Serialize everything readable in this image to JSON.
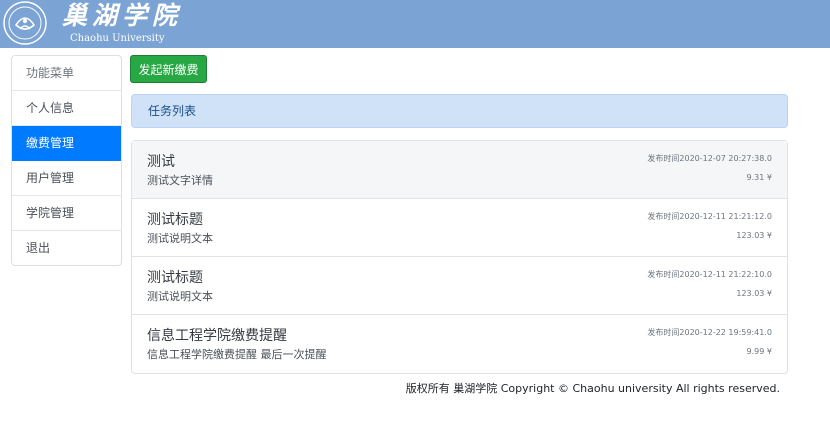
{
  "header": {
    "brand_cn": "巢湖学院",
    "brand_en": "Chaohu University",
    "colors": {
      "bar": "#7ba3d3"
    }
  },
  "sidebar": {
    "items": [
      {
        "label": "功能菜单",
        "type": "header"
      },
      {
        "label": "个人信息"
      },
      {
        "label": "缴费管理",
        "active": true
      },
      {
        "label": "用户管理"
      },
      {
        "label": "学院管理"
      },
      {
        "label": "退出"
      }
    ],
    "active_color": "#007bff"
  },
  "actions": {
    "new_payment_label": "发起新缴费"
  },
  "task_panel": {
    "title": "任务列表"
  },
  "tasks": [
    {
      "title": "测试",
      "desc": "测试文字详情",
      "time": "发布时间2020-12-07 20:27:38.0",
      "amount": "9.31 ¥"
    },
    {
      "title": "测试标题",
      "desc": "测试说明文本",
      "time": "发布时间2020-12-11 21:21:12.0",
      "amount": "123.03 ¥"
    },
    {
      "title": "测试标题",
      "desc": "测试说明文本",
      "time": "发布时间2020-12-11 21:22:10.0",
      "amount": "123.03 ¥"
    },
    {
      "title": "信息工程学院缴费提醒",
      "desc": "信息工程学院缴费提醒 最后一次提醒",
      "time": "发布时间2020-12-22 19:59:41.0",
      "amount": "9.99 ¥"
    }
  ],
  "footer": {
    "text": "版权所有 巢湖学院 Copyright © Chaohu university All rights reserved."
  }
}
